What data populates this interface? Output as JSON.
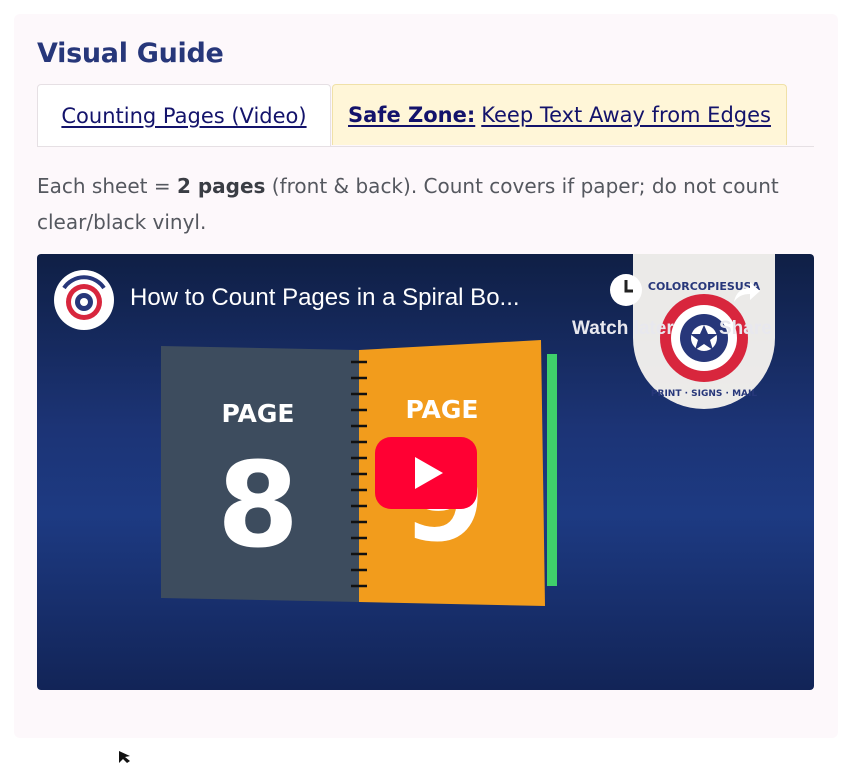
{
  "section": {
    "title": "Visual Guide"
  },
  "tabs": [
    {
      "label": "Counting Pages (Video)"
    },
    {
      "label_bold": "Safe Zone:",
      "label": "Keep Text Away from Edges"
    }
  ],
  "description": {
    "prefix": "Each sheet = ",
    "emphasis": "2 pages",
    "suffix": " (front & back). Count covers if paper; do not count clear/black vinyl."
  },
  "video": {
    "title": "How to Count Pages in a Spiral Bo...",
    "watch_later_label": "Watch later",
    "share_label": "Share",
    "left_page": {
      "label": "PAGE",
      "number": "8"
    },
    "right_page": {
      "label": "PAGE",
      "number": "9"
    },
    "badge_brand": "COLORCOPIESUSA",
    "badge_tagline": "PRINT · SIGNS · MAIL",
    "colors": {
      "brand_red": "#d8263d",
      "brand_blue": "#27377a",
      "youtube_red": "#ff0033",
      "orange_page": "#f29c1c",
      "slate_page": "#3d4c5e"
    }
  }
}
